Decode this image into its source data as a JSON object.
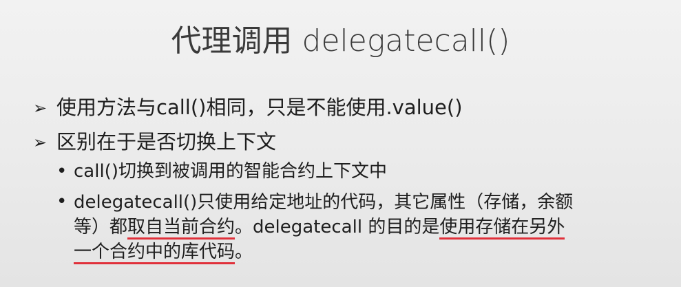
{
  "slide": {
    "title": "代理调用 delegatecall()",
    "bullets": [
      {
        "marker": "➢",
        "text": "使用方法与call()相同，只是不能使用.value()"
      },
      {
        "marker": "➢",
        "text": "区别在于是否切换上下文"
      }
    ],
    "sub_bullets": [
      {
        "marker": "•",
        "text": "call()切换到被调用的智能合约上下文中"
      },
      {
        "marker": "•",
        "line1": "delegatecall()只使用给定地址的代码，其它属性（存储，余额",
        "line2_a": "等）都",
        "line2_u1": "取自当前合约",
        "line2_b": "。delegatecall 的目的是",
        "line2_u2": "使用存储在另外",
        "line3_u": "一个合约中的库代码",
        "line3_b": "。"
      }
    ]
  },
  "colors": {
    "underline": "#e0303a",
    "text": "#1e1e1e"
  }
}
